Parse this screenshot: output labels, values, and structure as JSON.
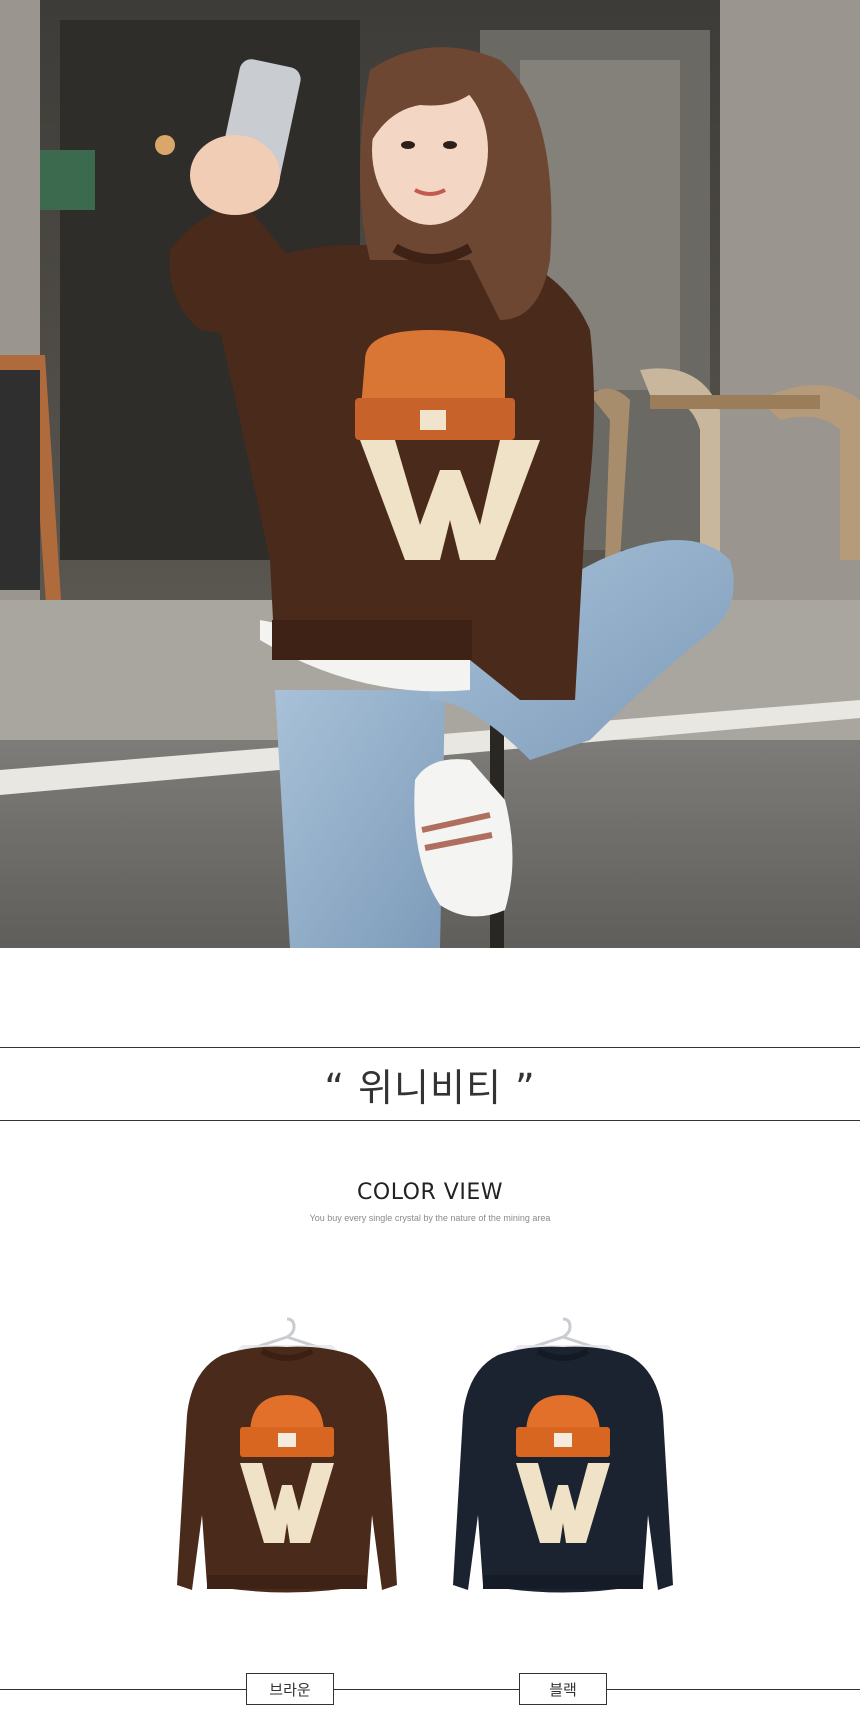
{
  "product_title": "“ 위니비티 ”",
  "color_view": {
    "heading": "COLOR VIEW",
    "subtitle": "You buy every single crystal by the nature of the mining area"
  },
  "colors": [
    {
      "label": "브라운",
      "hex": "#4a2a1b"
    },
    {
      "label": "블랙",
      "hex": "#1c2330"
    }
  ],
  "graphic": {
    "letter": "W",
    "beanie_color": "#e3702a",
    "letter_color": "#efe2c6"
  }
}
